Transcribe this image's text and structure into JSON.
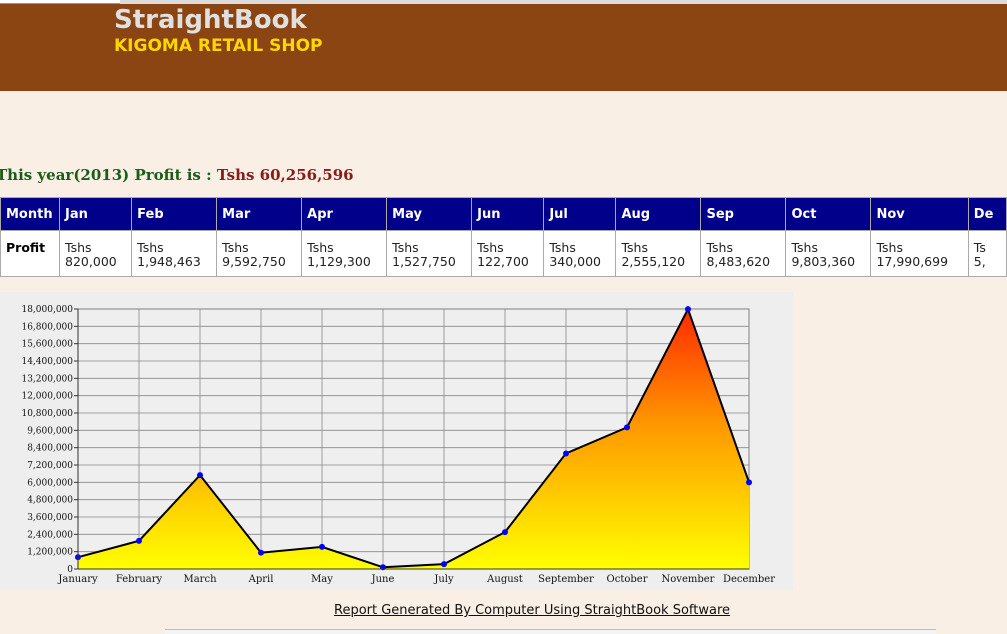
{
  "app": {
    "name": "StraightBook",
    "shop": "KIGOMA RETAIL SHOP"
  },
  "summary": {
    "label": "This year(2013) Profit is : ",
    "amount": "Tshs 60,256,596"
  },
  "table": {
    "row_header": "Month",
    "row_label": "Profit",
    "columns": [
      {
        "month": "Jan",
        "currency": "Tshs",
        "value": "820,000"
      },
      {
        "month": "Feb",
        "currency": "Tshs",
        "value": "1,948,463"
      },
      {
        "month": "Mar",
        "currency": "Tshs",
        "value": "9,592,750"
      },
      {
        "month": "Apr",
        "currency": "Tshs",
        "value": "1,129,300"
      },
      {
        "month": "May",
        "currency": "Tshs",
        "value": "1,527,750"
      },
      {
        "month": "Jun",
        "currency": "Tshs",
        "value": "122,700"
      },
      {
        "month": "Jul",
        "currency": "Tshs",
        "value": "340,000"
      },
      {
        "month": "Aug",
        "currency": "Tshs",
        "value": "2,555,120"
      },
      {
        "month": "Sep",
        "currency": "Tshs",
        "value": "8,483,620"
      },
      {
        "month": "Oct",
        "currency": "Tshs",
        "value": "9,803,360"
      },
      {
        "month": "Nov",
        "currency": "Tshs",
        "value": "17,990,699"
      },
      {
        "month": "De",
        "currency": "Ts",
        "value": "5,"
      }
    ]
  },
  "chart_data": {
    "type": "area",
    "categories": [
      "January",
      "February",
      "March",
      "April",
      "May",
      "June",
      "July",
      "August",
      "September",
      "October",
      "November",
      "December"
    ],
    "values": [
      820000,
      1948463,
      6500000,
      1129300,
      1527750,
      122700,
      340000,
      2555120,
      8000000,
      9803360,
      17990699,
      6000000
    ],
    "ylim": [
      0,
      18000000
    ],
    "yticks": [
      0,
      1200000,
      2400000,
      3600000,
      4800000,
      6000000,
      7200000,
      8400000,
      9600000,
      10800000,
      12000000,
      13200000,
      14400000,
      15600000,
      16800000,
      18000000
    ],
    "ytick_labels": [
      "0",
      "1,200,000",
      "2,400,000",
      "3,600,000",
      "4,800,000",
      "6,000,000",
      "7,200,000",
      "8,400,000",
      "9,600,000",
      "10,800,000",
      "12,000,000",
      "13,200,000",
      "14,400,000",
      "15,600,000",
      "16,800,000",
      "18,000,000"
    ],
    "grid": true,
    "colors": {
      "fill_top": "#ff2a00",
      "fill_bottom": "#ffff00",
      "line": "#000000",
      "point": "#0000ff",
      "grid": "#888888",
      "background": "#eeeeee"
    }
  },
  "footer": {
    "text": "Report Generated By Computer Using StraightBook Software"
  }
}
